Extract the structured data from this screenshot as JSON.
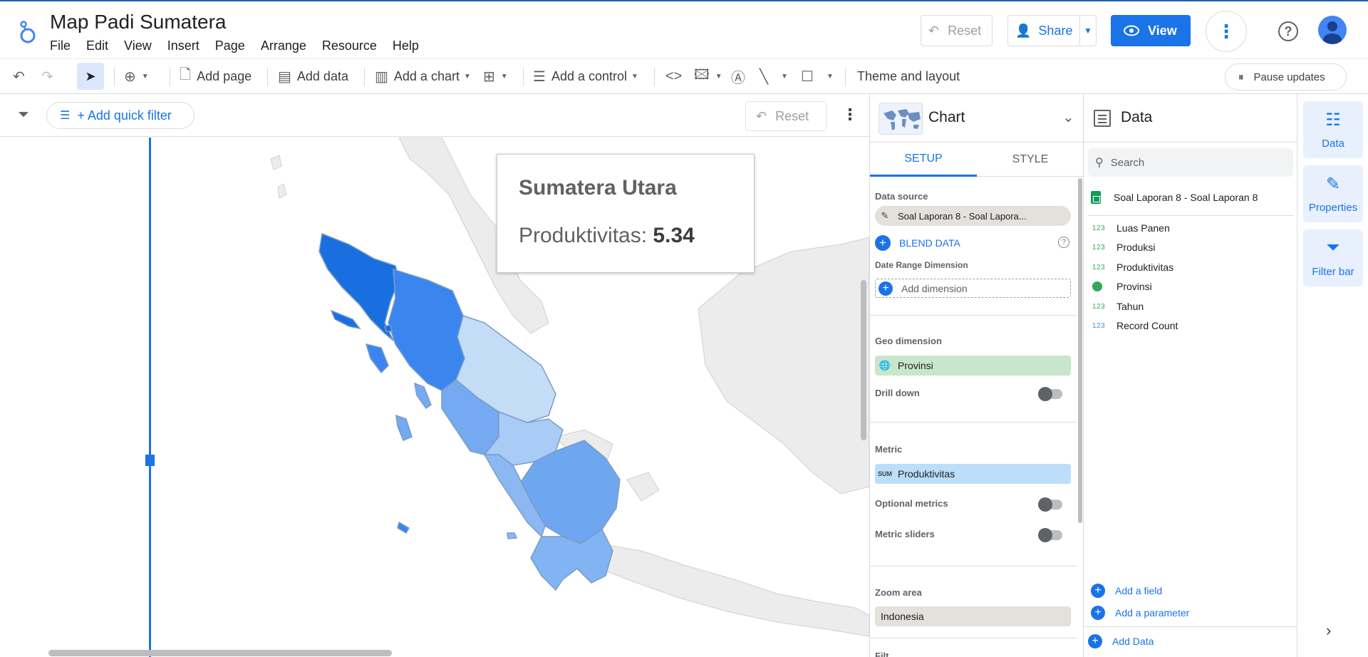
{
  "app": {
    "title": "Map Padi Sumatera",
    "menu": [
      "File",
      "Edit",
      "View",
      "Insert",
      "Page",
      "Arrange",
      "Resource",
      "Help"
    ],
    "reset_label": "Reset",
    "share_label": "Share",
    "view_label": "View",
    "brand_color": "#1a73e8"
  },
  "toolbar": {
    "add_page": "Add page",
    "add_data": "Add data",
    "add_chart": "Add a chart",
    "add_control": "Add a control",
    "theme_layout": "Theme and layout",
    "pause_updates": "Pause updates"
  },
  "filterbar": {
    "quick_filter": "+ Add quick filter",
    "reset": "Reset"
  },
  "tooltip": {
    "region": "Sumatera Utara",
    "metric_label": "Produktivitas:",
    "metric_value": "5.34"
  },
  "chart_panel": {
    "title": "Chart",
    "tab_setup": "SETUP",
    "tab_style": "STYLE",
    "data_source_label": "Data source",
    "data_source_value": "Soal Laporan 8 - Soal Lapora...",
    "blend_data": "BLEND DATA",
    "date_range_label": "Date Range Dimension",
    "add_dimension": "Add dimension",
    "geo_label": "Geo dimension",
    "geo_value": "Provinsi",
    "drill_down": "Drill down",
    "metric_label": "Metric",
    "metric_agg": "SUM",
    "metric_value": "Produktivitas",
    "optional_metrics": "Optional metrics",
    "metric_sliders": "Metric sliders",
    "zoom_label": "Zoom area",
    "zoom_value": "Indonesia",
    "next_label": "Filt..."
  },
  "data_panel": {
    "title": "Data",
    "search_placeholder": "Search",
    "source": "Soal Laporan 8 - Soal Laporan 8",
    "fields": [
      {
        "type": "123",
        "name": "Luas Panen"
      },
      {
        "type": "123",
        "name": "Produksi"
      },
      {
        "type": "123",
        "name": "Produktivitas"
      },
      {
        "type": "geo",
        "name": "Provinsi"
      },
      {
        "type": "123",
        "name": "Tahun"
      },
      {
        "type": "123",
        "name": "Record Count"
      }
    ],
    "add_field": "Add a field",
    "add_parameter": "Add a parameter",
    "add_data": "Add Data"
  },
  "rail": {
    "data": "Data",
    "properties": "Properties",
    "filter_bar": "Filter bar"
  }
}
